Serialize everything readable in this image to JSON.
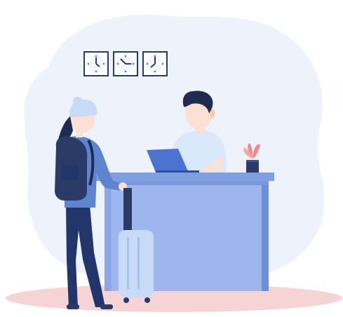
{
  "illustration": {
    "subject": "hotel-reception",
    "colors": {
      "background_blob": "#eef2fb",
      "floor_shadow": "#f6d3d5",
      "desk_top": "#7f9fe0",
      "desk_front": "#9db7ee",
      "desk_side": "#6f8fd4",
      "clerk_shirt": "#d9e9fb",
      "clerk_hair": "#1f2c4f",
      "skin": "#fbe1d2",
      "laptop": "#4a74cf",
      "traveler_jacket": "#5f84cf",
      "traveler_pants": "#22366b",
      "backpack": "#2a3b67",
      "luggage": "#c7dbf7",
      "clock_face": "#ffffff",
      "clock_border": "#2a3b67",
      "plant": "#f08a86",
      "pot": "#2a3b67"
    },
    "icons": {
      "clock_1": "clock-icon",
      "clock_2": "clock-icon",
      "clock_3": "clock-icon"
    }
  }
}
